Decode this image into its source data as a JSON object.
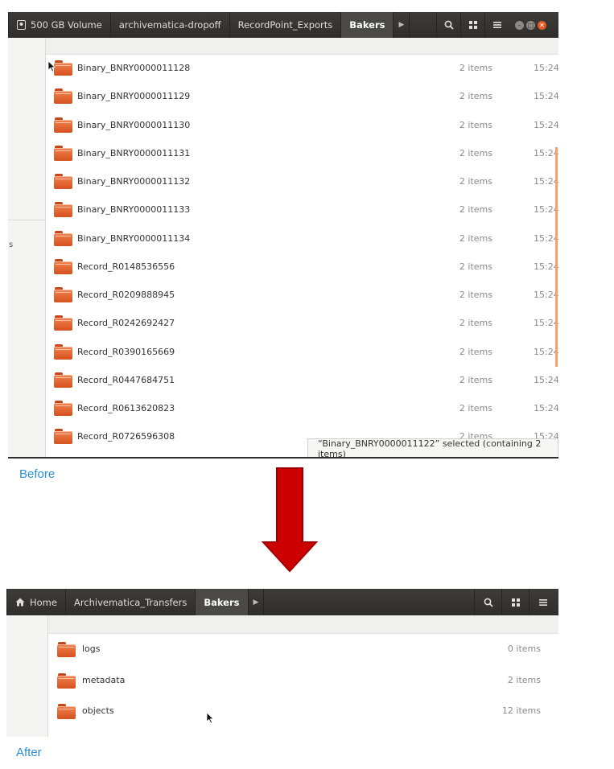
{
  "before": {
    "breadcrumbs": [
      {
        "label": "500 GB Volume",
        "icon": "drive-icon"
      },
      {
        "label": "archivematica-dropoff"
      },
      {
        "label": "RecordPoint_Exports"
      },
      {
        "label": "Bakers",
        "active": true
      }
    ],
    "sidebar_partial_text": "s",
    "files": [
      {
        "name": "Binary_BNRY0000011128",
        "size": "2 items",
        "time": "15:24"
      },
      {
        "name": "Binary_BNRY0000011129",
        "size": "2 items",
        "time": "15:24"
      },
      {
        "name": "Binary_BNRY0000011130",
        "size": "2 items",
        "time": "15:24"
      },
      {
        "name": "Binary_BNRY0000011131",
        "size": "2 items",
        "time": "15:24"
      },
      {
        "name": "Binary_BNRY0000011132",
        "size": "2 items",
        "time": "15:24"
      },
      {
        "name": "Binary_BNRY0000011133",
        "size": "2 items",
        "time": "15:24"
      },
      {
        "name": "Binary_BNRY0000011134",
        "size": "2 items",
        "time": "15:24"
      },
      {
        "name": "Record_R0148536556",
        "size": "2 items",
        "time": "15:24"
      },
      {
        "name": "Record_R0209888945",
        "size": "2 items",
        "time": "15:24"
      },
      {
        "name": "Record_R0242692427",
        "size": "2 items",
        "time": "15:24"
      },
      {
        "name": "Record_R0390165669",
        "size": "2 items",
        "time": "15:24"
      },
      {
        "name": "Record_R0447684751",
        "size": "2 items",
        "time": "15:24"
      },
      {
        "name": "Record_R0613620823",
        "size": "2 items",
        "time": "15:24"
      },
      {
        "name": "Record_R0726596308",
        "size": "2 items",
        "time": "15:24"
      }
    ],
    "status_text": "“Binary_BNRY0000011122” selected (containing 2 items)",
    "caption": "Before"
  },
  "after": {
    "breadcrumbs": [
      {
        "label": "Home",
        "icon": "home-icon"
      },
      {
        "label": "Archivematica_Transfers"
      },
      {
        "label": "Bakers",
        "active": true
      }
    ],
    "files": [
      {
        "name": "logs",
        "size": "0 items"
      },
      {
        "name": "metadata",
        "size": "2 items"
      },
      {
        "name": "objects",
        "size": "12 items"
      }
    ],
    "caption": "After"
  },
  "colors": {
    "headerbar": "#36352f",
    "folder_orange": "#e8672f",
    "caption_blue": "#2b8fd6",
    "arrow_red": "#cc0000"
  }
}
